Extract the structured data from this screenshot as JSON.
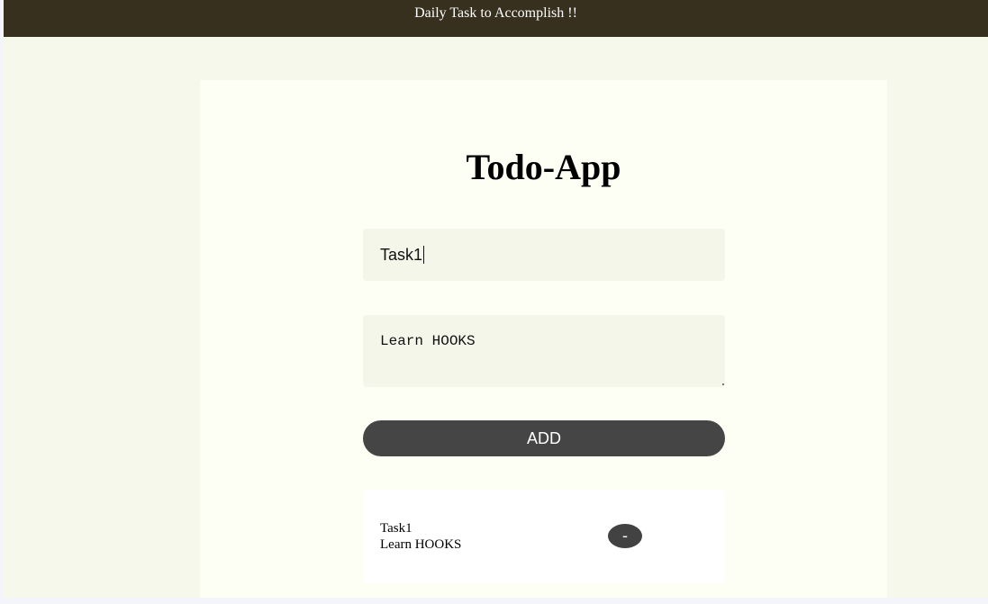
{
  "header": {
    "text": "Daily Task to Accomplish !!"
  },
  "app": {
    "title": "Todo-App"
  },
  "form": {
    "title_value": "Task1",
    "description_value": "Learn HOOKS",
    "add_label": "ADD"
  },
  "tasks": [
    {
      "title": "Task1",
      "description": "Learn HOOKS",
      "remove_label": "-"
    }
  ],
  "colors": {
    "header_bg": "#37301e",
    "page_bg": "#f5f8eb",
    "card_bg": "#fdfff4",
    "button_bg": "#454545"
  }
}
